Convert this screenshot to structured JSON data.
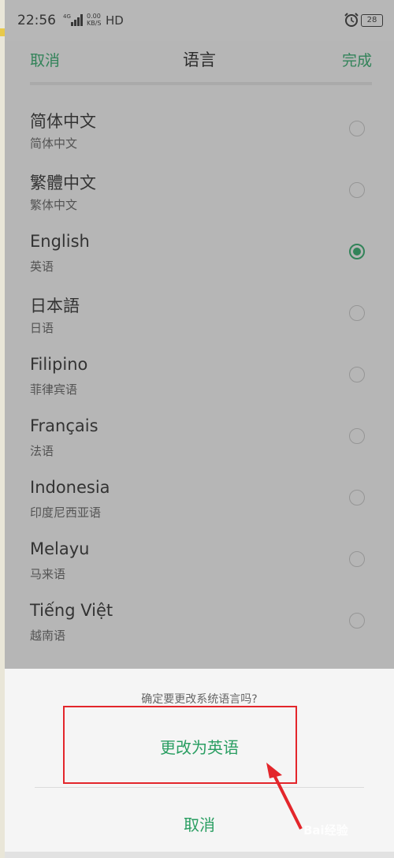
{
  "status_bar": {
    "time": "22:56",
    "network_signal": "4G",
    "network_speed_top": "0.00",
    "network_speed_bottom": "KB/S",
    "hd": "HD",
    "alarm_icon": "alarm-clock-icon",
    "battery": "28"
  },
  "nav": {
    "cancel": "取消",
    "title": "语言",
    "done": "完成"
  },
  "languages": [
    {
      "name": "简体中文",
      "subtitle": "简体中文",
      "selected": false
    },
    {
      "name": "繁體中文",
      "subtitle": "繁体中文",
      "selected": false
    },
    {
      "name": "English",
      "subtitle": "英语",
      "selected": true
    },
    {
      "name": "日本語",
      "subtitle": "日语",
      "selected": false
    },
    {
      "name": "Filipino",
      "subtitle": "菲律宾语",
      "selected": false
    },
    {
      "name": "Français",
      "subtitle": "法语",
      "selected": false
    },
    {
      "name": "Indonesia",
      "subtitle": "印度尼西亚语",
      "selected": false
    },
    {
      "name": "Melayu",
      "subtitle": "马来语",
      "selected": false
    },
    {
      "name": "Tiếng Việt",
      "subtitle": "越南语",
      "selected": false
    }
  ],
  "dialog": {
    "prompt": "确定要更改系统语言吗?",
    "confirm": "更改为英语",
    "cancel": "取消"
  },
  "watermark": "Bai经验",
  "colors": {
    "accent": "#2a9e62",
    "annotation": "#e3262b"
  }
}
